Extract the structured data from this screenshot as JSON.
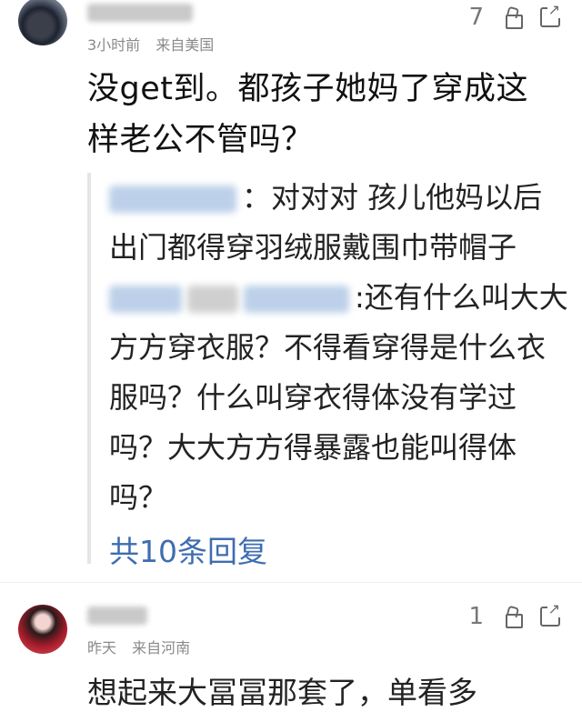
{
  "comments": [
    {
      "like_count": "7",
      "meta": {
        "time": "3小时前",
        "location": "来自美国"
      },
      "content": "没get到。都孩子她妈了穿成这样老公不管吗？",
      "replies": [
        {
          "text": "：对对对 孩儿他妈以后出门都得穿羽绒服戴围巾带帽子"
        },
        {
          "text": ":还有什么叫大大方方穿衣服？不得看穿得是什么衣服吗？什么叫穿衣得体没有学过吗？大大方方得暴露也能叫得体吗？"
        }
      ],
      "more_replies_label": "共10条回复"
    },
    {
      "like_count": "1",
      "meta": {
        "time": "昨天",
        "location": "来自河南"
      },
      "content_partial": "想起来大冨冨那套了，单看多"
    }
  ]
}
